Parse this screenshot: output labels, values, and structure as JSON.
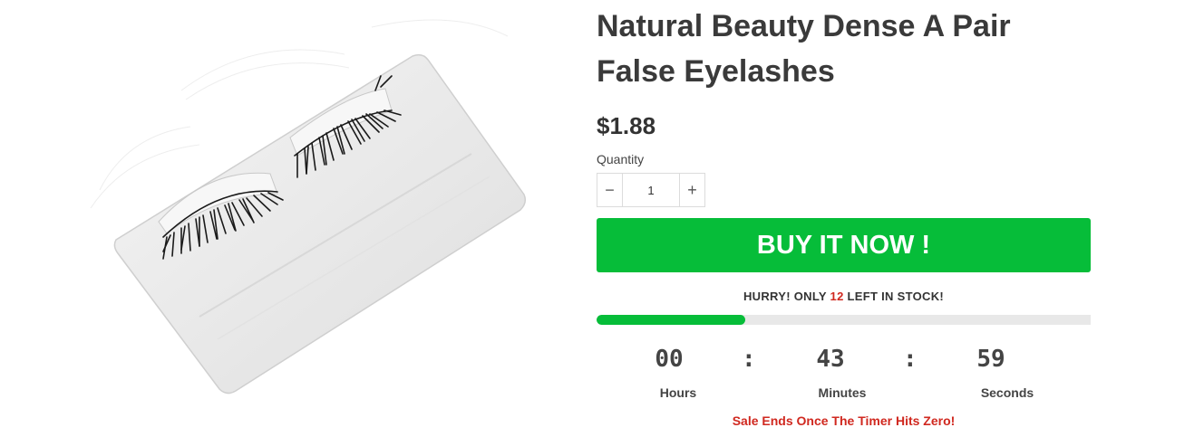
{
  "product": {
    "title": "Natural Beauty Dense A Pair False Eyelashes",
    "price": "$1.88",
    "image_alt": "false-eyelashes-product-image"
  },
  "quantity": {
    "label": "Quantity",
    "minus": "−",
    "plus": "+",
    "value": "1"
  },
  "buy_button": {
    "label": "BUY IT NOW !"
  },
  "stock": {
    "prefix": "HURRY! ONLY",
    "count": "12",
    "suffix": "LEFT IN STOCK!",
    "progress_fraction": 0.3
  },
  "timer": {
    "hours": "00",
    "minutes": "43",
    "seconds": "59",
    "separator": ":",
    "hours_label": "Hours",
    "minutes_label": "Minutes",
    "seconds_label": "Seconds",
    "note": "Sale Ends Once The Timer Hits Zero!"
  },
  "colors": {
    "accent_green": "#06bd39",
    "alert_red": "#d0281f"
  }
}
